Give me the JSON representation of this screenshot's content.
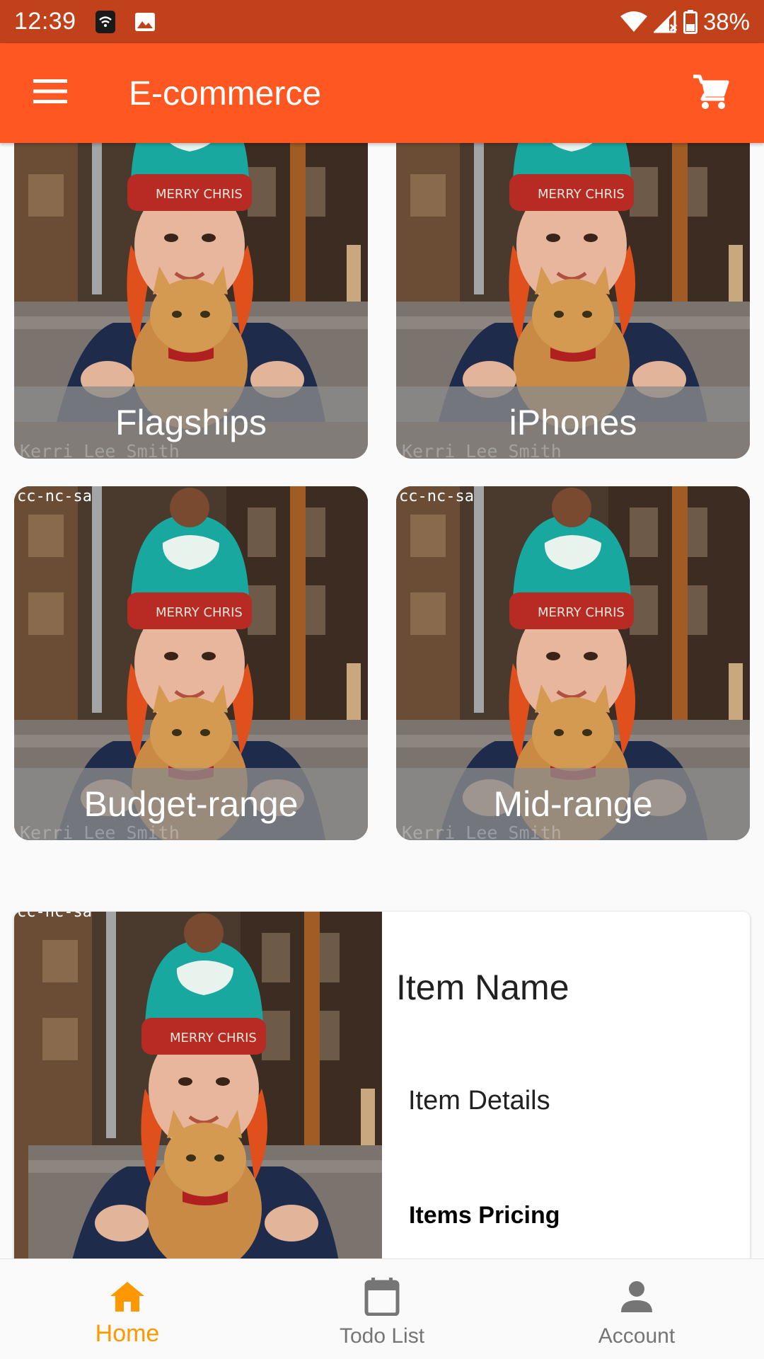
{
  "status_bar": {
    "time": "12:39",
    "battery": "38%"
  },
  "app_bar": {
    "title": "E-commerce",
    "menu_icon": "hamburger-menu-icon",
    "cart_icon": "shopping-cart-icon"
  },
  "categories": [
    {
      "label": "Flagships"
    },
    {
      "label": "iPhones"
    },
    {
      "label": "Budget-range"
    },
    {
      "label": "Mid-range"
    }
  ],
  "photo_watermark": {
    "license": "cc-nc-sa",
    "credit": "Kerri Lee Smith"
  },
  "item_card": {
    "name": "Item Name",
    "details": "Item Details",
    "pricing": "Items Pricing"
  },
  "bottom_nav": [
    {
      "label": "Home",
      "icon": "home-icon",
      "active": true
    },
    {
      "label": "Todo List",
      "icon": "calendar-icon",
      "active": false
    },
    {
      "label": "Account",
      "icon": "account-icon",
      "active": false
    }
  ],
  "colors": {
    "status_bar": "#c1411a",
    "app_bar": "#ff5722",
    "active_nav": "#ff9800",
    "inactive_nav": "#757575"
  }
}
